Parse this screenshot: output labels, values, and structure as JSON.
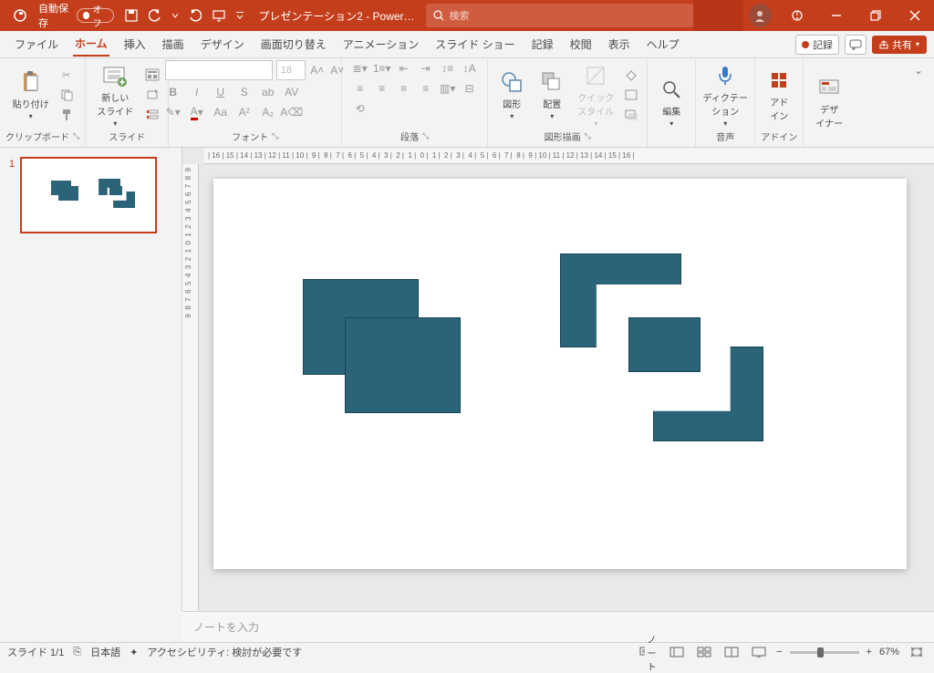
{
  "title": {
    "autosave_label": "自動保存",
    "autosave_state": "オフ",
    "doc": "プレゼンテーション2 - Power…",
    "search_placeholder": "検索"
  },
  "tabs": {
    "items": [
      "ファイル",
      "ホーム",
      "挿入",
      "描画",
      "デザイン",
      "画面切り替え",
      "アニメーション",
      "スライド ショー",
      "記録",
      "校閲",
      "表示",
      "ヘルプ"
    ],
    "active_index": 1,
    "record": "記録",
    "share": "共有"
  },
  "ribbon": {
    "clipboard": {
      "paste": "貼り付け",
      "label": "クリップボード"
    },
    "slide": {
      "new": "新しい\nスライド",
      "label": "スライド"
    },
    "font": {
      "label": "フォント",
      "size": "18"
    },
    "para": {
      "label": "段落"
    },
    "drawing": {
      "shape": "図形",
      "arrange": "配置",
      "quick": "クイック\nスタイル",
      "label": "図形描画"
    },
    "edit": {
      "label": "編集"
    },
    "dict": {
      "label_btn": "ディクテー\nション",
      "label": "音声"
    },
    "addin": {
      "label_btn": "アド\nイン",
      "label": "アドイン"
    },
    "designer": {
      "label": "デザ\nイナー"
    }
  },
  "thumb": {
    "num": "1"
  },
  "ruler_h": "| 16 | 15 | 14 | 13 | 12 | 11 | 10 |  9 |  8 |  7 |  6 |  5 |  4 |  3 |  2 |  1 |  0 |  1 |  2 |  3 |  4 |  5 |  6 |  7 |  8 |  9 | 10 | 11 | 12 | 13 | 14 | 15 | 16 |",
  "notes": {
    "placeholder": "ノートを入力"
  },
  "status": {
    "slide": "スライド 1/1",
    "lang": "日本語",
    "a11y": "アクセシビリティ: 検討が必要です",
    "notes_btn": "ノート",
    "zoom": "67%"
  }
}
